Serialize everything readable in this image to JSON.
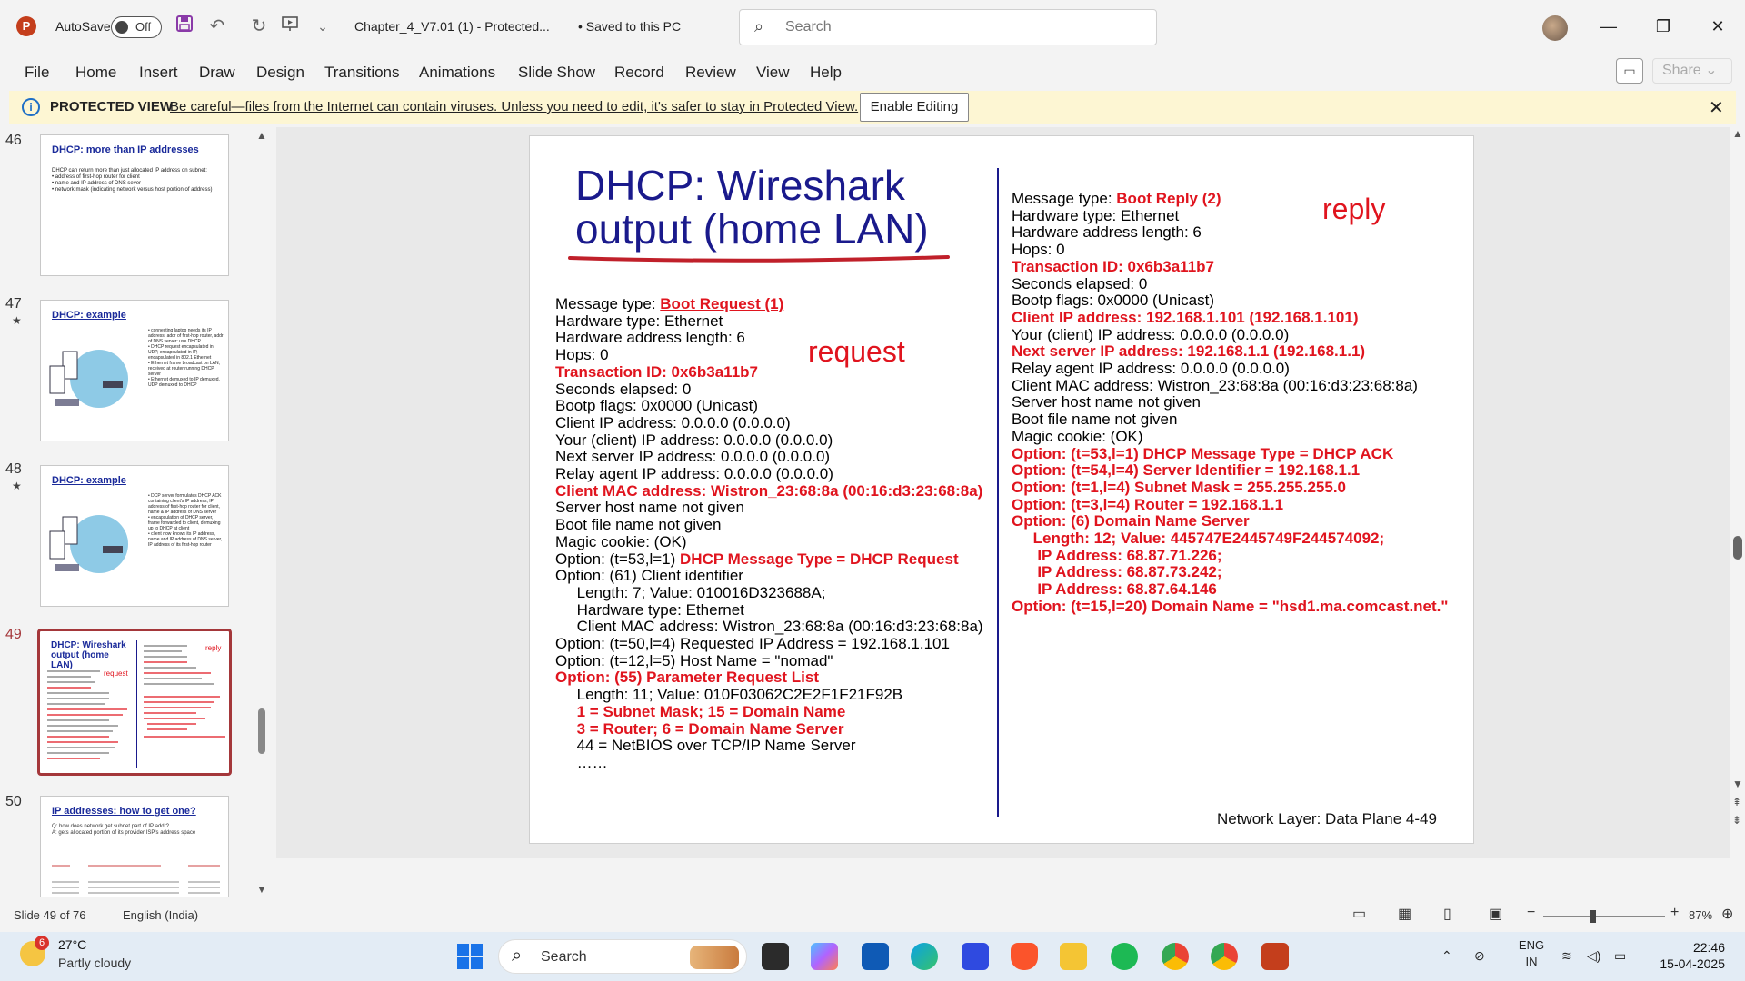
{
  "titlebar": {
    "app_icon": "P",
    "autosave_label": "AutoSave",
    "autosave_state": "Off",
    "doc_title": "Chapter_4_V7.01 (1)  -  Protected...",
    "saved_status": "• Saved to this PC",
    "search_placeholder": "Search"
  },
  "ribbon_tabs": [
    "File",
    "Home",
    "Insert",
    "Draw",
    "Design",
    "Transitions",
    "Animations",
    "Slide Show",
    "Record",
    "Review",
    "View",
    "Help"
  ],
  "share_label": "Share",
  "protected": {
    "title": "PROTECTED VIEW",
    "message": "Be careful—files from the Internet can contain viruses. Unless you need to edit, it's safer to stay in Protected View.",
    "button": "Enable Editing"
  },
  "thumbnails": [
    {
      "num": "46",
      "title": "DHCP: more than IP addresses",
      "starred": false,
      "body": "DHCP can return more than just allocated IP address on subnet:\n• address of first-hop router for client\n• name and IP address of DNS sever\n• network mask (indicating network versus host portion of address)"
    },
    {
      "num": "47",
      "title": "DHCP: example",
      "starred": true,
      "body": "• connecting laptop needs its IP address, addr of first-hop router, addr of DNS server: use DHCP\n• DHCP request encapsulated in UDP, encapsulated in IP, encapsulated in 802.1 Ethernet\n• Ethernet frame broadcast on LAN, received at router running DHCP server\n• Ethernet demuxed to IP demuxed, UDP demuxed to DHCP"
    },
    {
      "num": "48",
      "title": "DHCP: example",
      "starred": true,
      "body": "• DCP server formulates DHCP ACK containing client's IP address, IP address of first-hop router for client, name & IP address of DNS server\n• encapsulation of DHCP server, frame forwarded to client, demuxing up to DHCP at client\n• client now knows its IP address, name and IP address of DNS server, IP address of its first-hop router"
    },
    {
      "num": "49",
      "title": "DHCP: Wireshark output (home LAN)",
      "starred": false,
      "body": ""
    },
    {
      "num": "50",
      "title": "IP addresses: how to get one?",
      "starred": false,
      "body": "Q: how does network get subnet part of IP addr?\nA: gets allocated portion of its provider ISP's address space"
    }
  ],
  "slide": {
    "title_line1": "DHCP: Wireshark",
    "title_line2": "output (home LAN)",
    "request_label": "request",
    "reply_label": "reply",
    "footer": "Network Layer: Data Plane  4-49",
    "left": [
      {
        "t": "Message type: ",
        "b": "Boot Request (1)",
        "style": "redu"
      },
      {
        "t": "Hardware type: Ethernet"
      },
      {
        "t": "Hardware address length: 6"
      },
      {
        "t": "Hops: 0"
      },
      {
        "b": "Transaction ID: 0x6b3a11b7",
        "style": "red"
      },
      {
        "t": "Seconds elapsed: 0"
      },
      {
        "t": "Bootp flags: 0x0000 (Unicast)"
      },
      {
        "t": "Client IP address: 0.0.0.0 (0.0.0.0)"
      },
      {
        "t": "Your (client) IP address: 0.0.0.0 (0.0.0.0)"
      },
      {
        "t": "Next server IP address: 0.0.0.0 (0.0.0.0)"
      },
      {
        "t": "Relay agent IP address: 0.0.0.0 (0.0.0.0)"
      },
      {
        "b": "Client MAC address: Wistron_23:68:8a (00:16:d3:23:68:8a)",
        "style": "red"
      },
      {
        "t": "Server host name not given"
      },
      {
        "t": "Boot file name not given"
      },
      {
        "t": "Magic cookie: (OK)"
      },
      {
        "t": "Option: (t=53,l=1) ",
        "b": "DHCP Message Type = DHCP Request",
        "style": "red"
      },
      {
        "t": "Option: (61) Client identifier"
      },
      {
        "t": "     Length: 7; Value: 010016D323688A;"
      },
      {
        "t": "     Hardware type: Ethernet"
      },
      {
        "t": "     Client MAC address: Wistron_23:68:8a (00:16:d3:23:68:8a)"
      },
      {
        "t": "Option: (t=50,l=4) Requested IP Address = 192.168.1.101"
      },
      {
        "t": "Option: (t=12,l=5) Host Name = \"nomad\""
      },
      {
        "b": "Option: (55) Parameter Request List",
        "style": "red"
      },
      {
        "t": "     Length: 11; Value: 010F03062C2E2F1F21F92B"
      },
      {
        "b": "     1 = Subnet Mask; 15 = Domain Name",
        "style": "red"
      },
      {
        "b": "     3 = Router; 6 = Domain Name Server",
        "style": "red"
      },
      {
        "t": "     44 = NetBIOS over TCP/IP Name Server"
      },
      {
        "t": "     ……"
      }
    ],
    "right": [
      {
        "t": "Message type: ",
        "b": "Boot Reply (2)",
        "style": "red"
      },
      {
        "t": "Hardware type: Ethernet"
      },
      {
        "t": "Hardware address length: 6"
      },
      {
        "t": "Hops: 0"
      },
      {
        "b": "Transaction ID: 0x6b3a11b7",
        "style": "red"
      },
      {
        "t": "Seconds elapsed: 0"
      },
      {
        "t": "Bootp flags: 0x0000 (Unicast)"
      },
      {
        "b": "Client IP address: 192.168.1.101 (192.168.1.101)",
        "style": "red"
      },
      {
        "t": "Your (client) IP address: 0.0.0.0 (0.0.0.0)"
      },
      {
        "b": "Next server IP address: 192.168.1.1 (192.168.1.1)",
        "style": "red"
      },
      {
        "t": "Relay agent IP address: 0.0.0.0 (0.0.0.0)"
      },
      {
        "t": "Client MAC address: Wistron_23:68:8a (00:16:d3:23:68:8a)"
      },
      {
        "t": "Server host name not given"
      },
      {
        "t": "Boot file name not given"
      },
      {
        "t": "Magic cookie: (OK)"
      },
      {
        "b": "Option: (t=53,l=1) DHCP Message Type = DHCP ACK",
        "style": "red"
      },
      {
        "b": "Option: (t=54,l=4) Server Identifier = 192.168.1.1",
        "style": "red"
      },
      {
        "b": "Option: (t=1,l=4) Subnet Mask = 255.255.255.0",
        "style": "red"
      },
      {
        "b": "Option: (t=3,l=4) Router = 192.168.1.1",
        "style": "red"
      },
      {
        "b": "Option: (6) Domain Name Server",
        "style": "red"
      },
      {
        "b": "     Length: 12; Value: 445747E2445749F244574092;",
        "style": "red"
      },
      {
        "b": "      IP Address: 68.87.71.226;",
        "style": "red"
      },
      {
        "b": "      IP Address: 68.87.73.242;",
        "style": "red"
      },
      {
        "b": "      IP Address: 68.87.64.146",
        "style": "red"
      },
      {
        "b": "Option: (t=15,l=20) Domain Name = \"hsd1.ma.comcast.net.\"",
        "style": "red"
      }
    ]
  },
  "status": {
    "slide_info": "Slide 49 of 76",
    "language": "English (India)",
    "zoom": "87%"
  },
  "taskbar": {
    "weather_badge": "6",
    "temperature": "27°C",
    "condition": "Partly cloudy",
    "search_label": "Search",
    "lang_line1": "ENG",
    "lang_line2": "IN",
    "time": "22:46",
    "date": "15-04-2025"
  },
  "colors": {
    "accent_red": "#e0141e",
    "title_blue": "#1a1a8c",
    "ppt_brand": "#c43e1c",
    "selected_thumb": "#a4373a"
  }
}
